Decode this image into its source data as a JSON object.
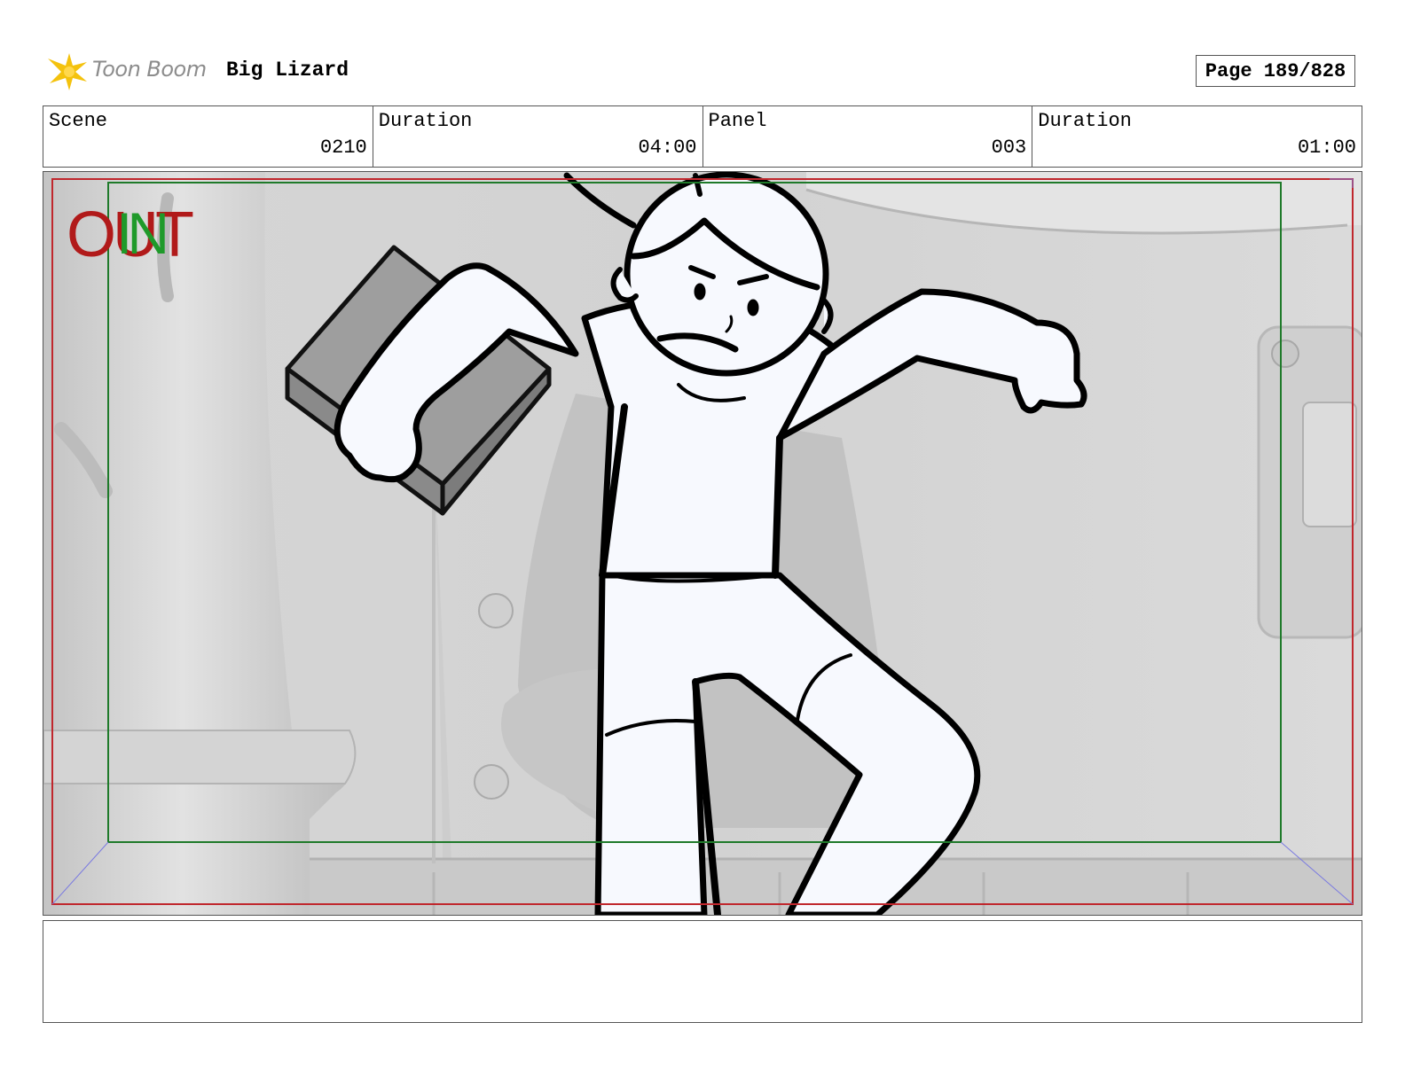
{
  "header": {
    "brand": "Toon Boom",
    "brand_icon": "toon-boom-star-icon",
    "brand_color": "#f4c20d",
    "project_title": "Big Lizard",
    "page_label": "Page 189/828"
  },
  "info": {
    "scene_label": "Scene",
    "scene_value": "0210",
    "scene_duration_label": "Duration",
    "scene_duration_value": "04:00",
    "panel_label": "Panel",
    "panel_value": "003",
    "panel_duration_label": "Duration",
    "panel_duration_value": "01:00"
  },
  "frame": {
    "out_mark": "OUT",
    "in_mark": "IN",
    "out_color": "#b11a1a",
    "in_color": "#1f9a2a"
  },
  "notes": {
    "text": ""
  }
}
